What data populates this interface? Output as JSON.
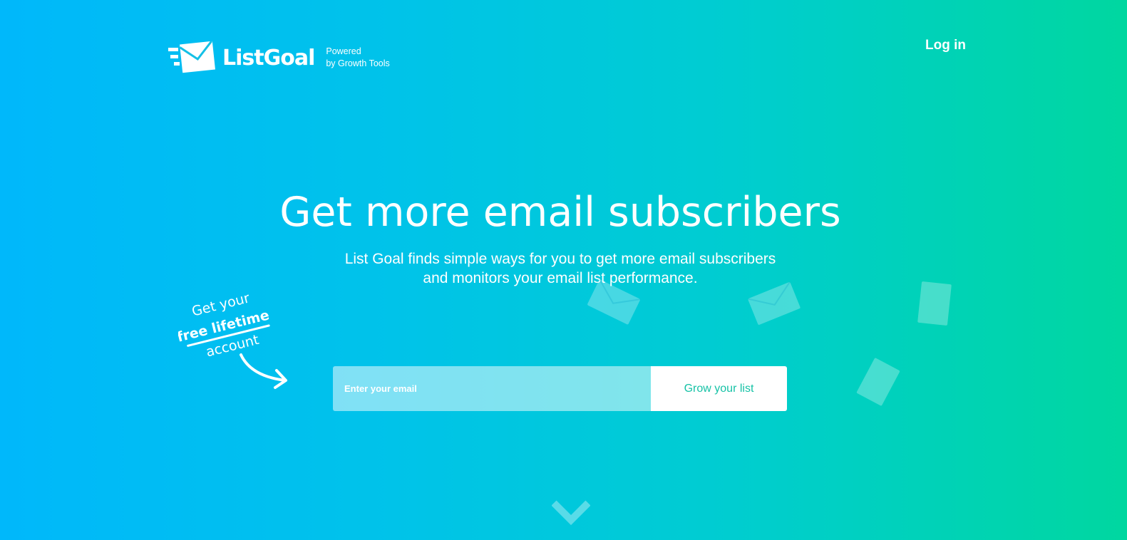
{
  "header": {
    "brand": "ListGoal",
    "powered_line1": "Powered",
    "powered_line2": "by Growth Tools",
    "login_label": "Log in"
  },
  "hero": {
    "title": "Get more email subscribers",
    "subtitle_line1": "List Goal finds simple ways for you to get more email subscribers",
    "subtitle_line2": "and monitors your email list performance."
  },
  "callout": {
    "line1": "Get your",
    "line2": "free lifetime",
    "line3": "account"
  },
  "signup": {
    "email_placeholder": "Enter your email",
    "submit_label": "Grow your list"
  },
  "icons": {
    "logo": "envelope-speed-icon",
    "scroll": "chevron-down-icon",
    "decor": "envelope-icon"
  },
  "colors": {
    "gradient_start": "#00b8fb",
    "gradient_end": "#00d7a0",
    "button_text": "#16c2a6"
  }
}
